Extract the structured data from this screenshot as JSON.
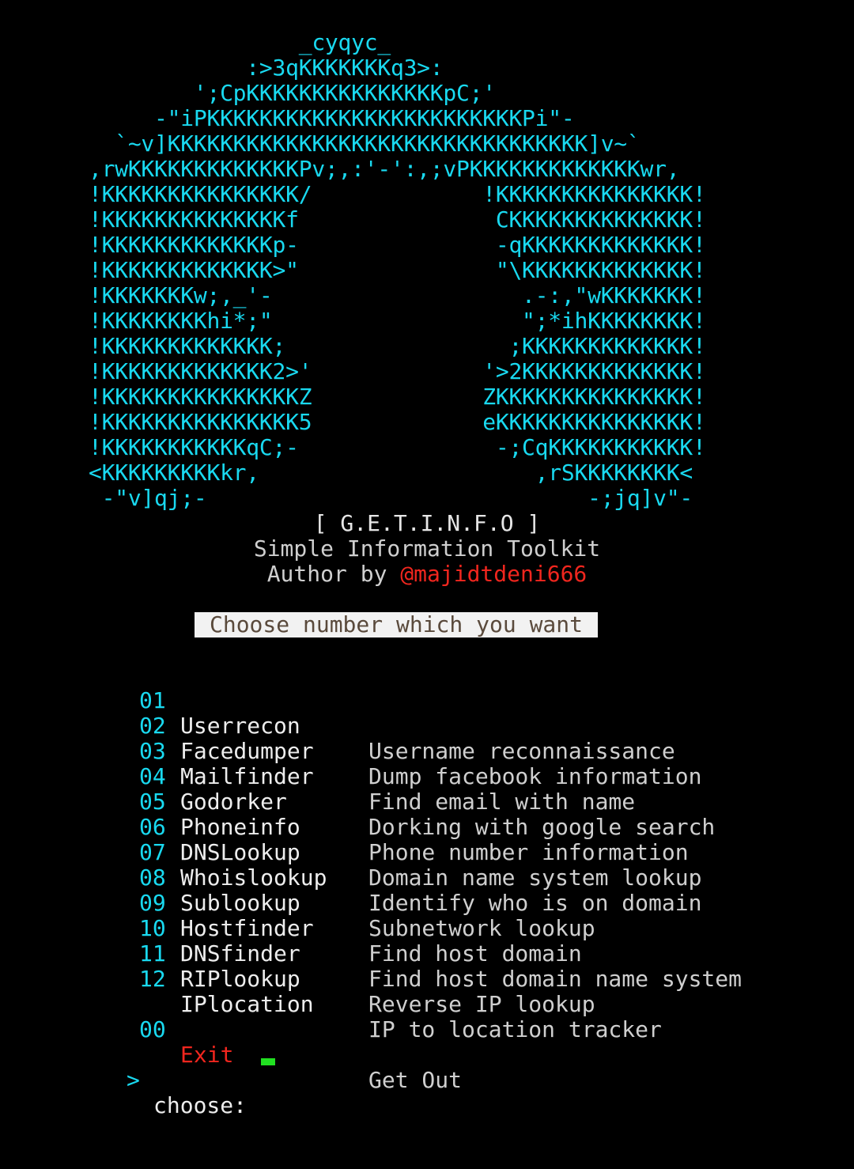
{
  "logo_art": [
    "                _cyqyc_",
    "            :>3qKKKKKKKq3>:",
    "        ';CpKKKKKKKKKKKKKKKpC;'",
    "     -\"iPKKKKKKKKKKKKKKKKKKKKKKKKPi\"-",
    "  `~v]KKKKKKKKKKKKKKKKKKKKKKKKKKKKKKKK]v~`",
    ",rwKKKKKKKKKKKKKPv;,:'-':,;vPKKKKKKKKKKKKKwr,",
    "!KKKKKKKKKKKKKKK/             !KKKKKKKKKKKKKKK!",
    "!KKKKKKKKKKKKKKf               CKKKKKKKKKKKKKK!",
    "!KKKKKKKKKKKKKp-               -qKKKKKKKKKKKKK!",
    "!KKKKKKKKKKKKK>\"               \"\\KKKKKKKKKKKKK!",
    "!KKKKKKKw;,_'-                   .-:,\"wKKKKKKK!",
    "!KKKKKKKKhi*;\"                   \";*ihKKKKKKKK!",
    "!KKKKKKKKKKKKK;                 ;KKKKKKKKKKKKK!",
    "!KKKKKKKKKKKKK2>'             '>2KKKKKKKKKKKKK!",
    "!KKKKKKKKKKKKKKKZ             ZKKKKKKKKKKKKKKK!",
    "!KKKKKKKKKKKKKKK5             eKKKKKKKKKKKKKKK!",
    "!KKKKKKKKKKKqC;-               -;CqKKKKKKKKKKK!",
    "<KKKKKKKKKkr,                     ,rSKKKKKKKK<",
    " -\"v]qj;-                             -;jq]v\"-"
  ],
  "header": {
    "title": "[ G.E.T.I.N.F.O ]",
    "subtitle": "Simple Information Toolkit",
    "author_prefix": "Author by ",
    "author_name": "@majidtdeni666"
  },
  "banner": "Choose number which you want",
  "menu": [
    {
      "num": "01",
      "tool": "Userrecon",
      "desc": "Username reconnaissance"
    },
    {
      "num": "02",
      "tool": "Facedumper",
      "desc": "Dump facebook information"
    },
    {
      "num": "03",
      "tool": "Mailfinder",
      "desc": "Find email with name"
    },
    {
      "num": "04",
      "tool": "Godorker",
      "desc": "Dorking with google search"
    },
    {
      "num": "05",
      "tool": "Phoneinfo",
      "desc": "Phone number information"
    },
    {
      "num": "06",
      "tool": "DNSLookup",
      "desc": "Domain name system lookup"
    },
    {
      "num": "07",
      "tool": "Whoislookup",
      "desc": "Identify who is on domain"
    },
    {
      "num": "08",
      "tool": "Sublookup",
      "desc": "Subnetwork lookup"
    },
    {
      "num": "09",
      "tool": "Hostfinder",
      "desc": "Find host domain"
    },
    {
      "num": "10",
      "tool": "DNSfinder",
      "desc": "Find host domain name system"
    },
    {
      "num": "11",
      "tool": "RIPlookup",
      "desc": "Reverse IP lookup"
    },
    {
      "num": "12",
      "tool": "IPlocation",
      "desc": "IP to location tracker"
    }
  ],
  "exit": {
    "num": "00",
    "tool": "Exit",
    "desc": "Get Out"
  },
  "prompt": {
    "arrow": ">",
    "label": "choose:"
  },
  "colors": {
    "background": "#000000",
    "cyan": "#19d9f0",
    "red": "#f0261e",
    "text": "#d8d8d8",
    "cursor": "#21e021",
    "banner_bg": "#f2f2f2",
    "banner_text": "#5a4a3c"
  }
}
